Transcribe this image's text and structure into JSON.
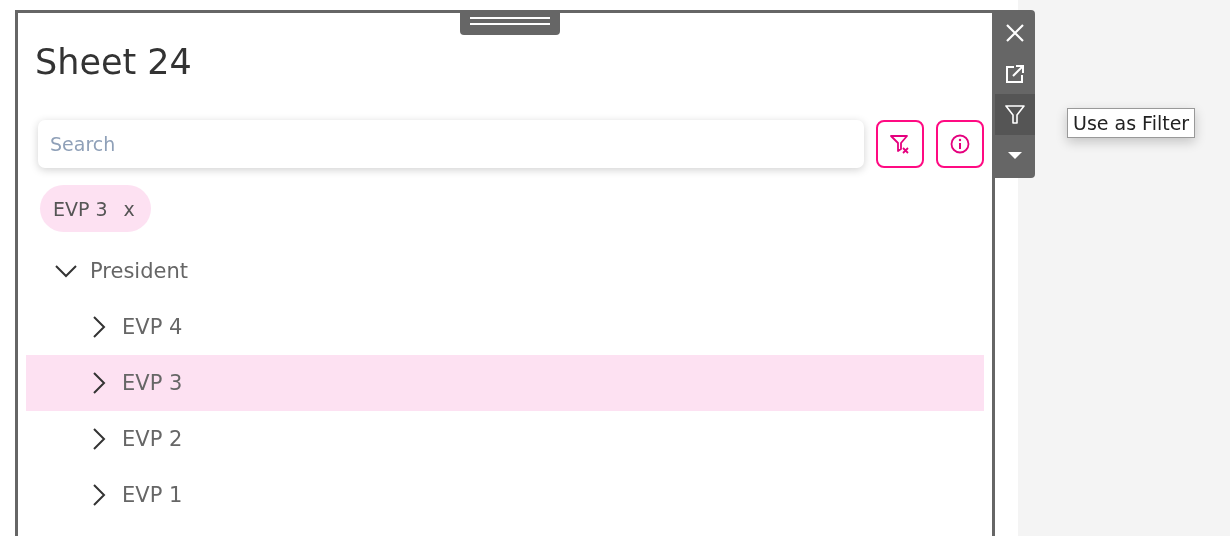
{
  "sheet": {
    "title": "Sheet 24"
  },
  "search": {
    "placeholder": "Search"
  },
  "actions": [
    {
      "kind": "clear-filter"
    },
    {
      "kind": "info"
    }
  ],
  "chips": [
    {
      "label": "EVP 3",
      "remove": "x"
    }
  ],
  "tree": [
    {
      "label": "President",
      "expanded": true,
      "selected": false,
      "children": [
        {
          "label": "EVP 4",
          "expanded": false,
          "selected": false
        },
        {
          "label": "EVP 3",
          "expanded": false,
          "selected": true
        },
        {
          "label": "EVP 2",
          "expanded": false,
          "selected": false
        },
        {
          "label": "EVP 1",
          "expanded": false,
          "selected": false
        }
      ]
    }
  ],
  "toolbar": [
    {
      "kind": "close",
      "active": false
    },
    {
      "kind": "popout",
      "active": false
    },
    {
      "kind": "filter",
      "active": true
    },
    {
      "kind": "more",
      "active": false
    }
  ],
  "tooltip": {
    "text": "Use as Filter"
  }
}
